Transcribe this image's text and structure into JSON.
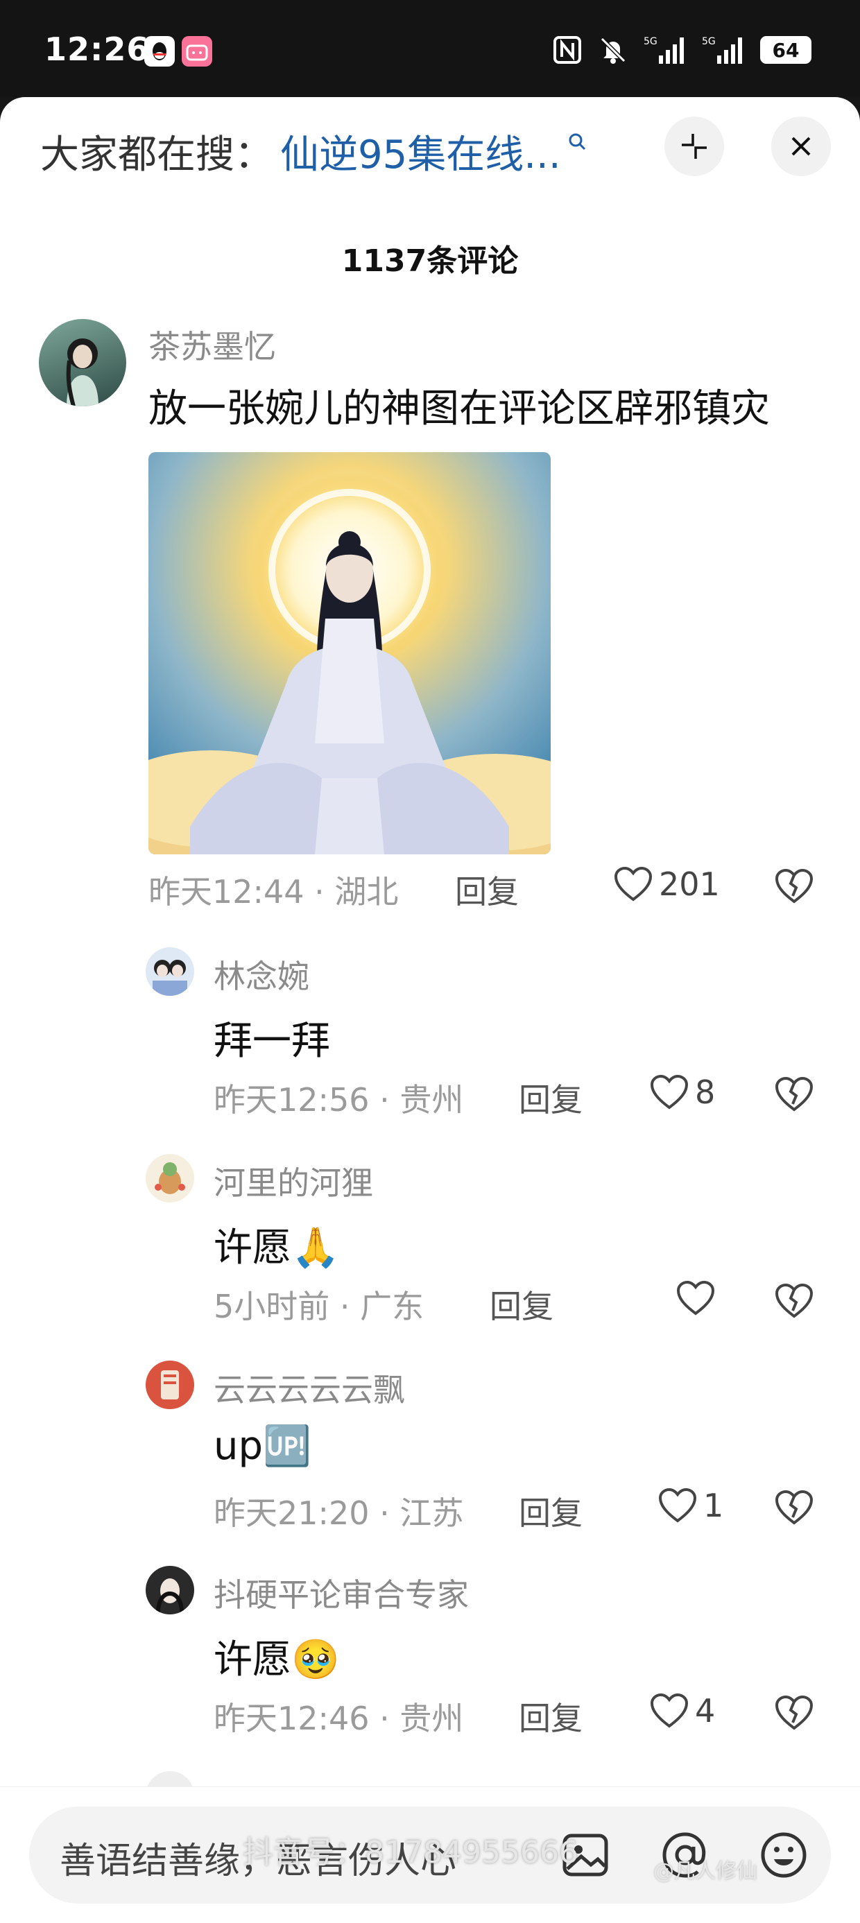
{
  "status_bar": {
    "time": "12:26",
    "battery": "64"
  },
  "header": {
    "search_prefix": "大家都在搜：",
    "search_term": "仙逆95集在线...",
    "minimize_icon": "minimize-icon",
    "close_icon": "close-icon"
  },
  "comment_count": "1137条评论",
  "comments": [
    {
      "user": "茶苏墨忆",
      "text": "放一张婉儿的神图在评论区辟邪镇灾",
      "time": "昨天12:44 · 湖北",
      "reply": "回复",
      "likes": "201",
      "has_image": true
    },
    {
      "user": "林念婉",
      "text": "拜一拜",
      "time": "昨天12:56 · 贵州",
      "reply": "回复",
      "likes": "8"
    },
    {
      "user": "河里的河狸",
      "text": "许愿🙏",
      "time": "5小时前 · 广东",
      "reply": "回复",
      "likes": ""
    },
    {
      "user": "云云云云云飘",
      "text": "up🆙",
      "time": "昨天21:20 · 江苏",
      "reply": "回复",
      "likes": "1"
    },
    {
      "user": "抖硬平论审合专家",
      "text": "许愿🥹",
      "time": "昨天12:46 · 贵州",
      "reply": "回复",
      "likes": "4"
    }
  ],
  "bottom": {
    "placeholder": "善语结善缘，恶言伤人心",
    "watermark": "抖音号：81784955666",
    "watermark2": "@凡人修仙"
  },
  "colors": {
    "link": "#1f5fa8",
    "meta": "#9a9a9a",
    "background": "#ffffff"
  }
}
